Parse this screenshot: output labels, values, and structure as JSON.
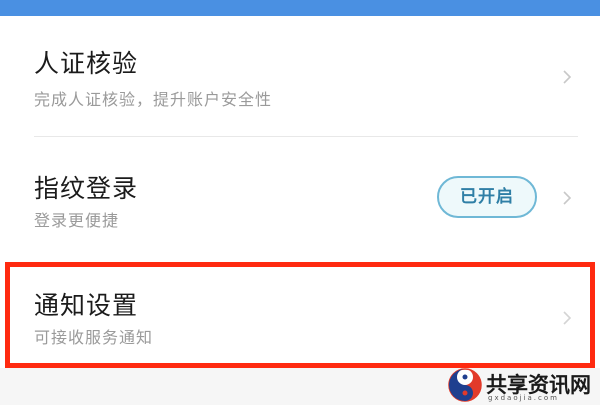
{
  "settings": {
    "items": [
      {
        "title": "人证核验",
        "subtitle": "完成人证核验，提升账户安全性"
      },
      {
        "title": "指纹登录",
        "subtitle": "登录更便捷",
        "badge": "已开启"
      },
      {
        "title": "通知设置",
        "subtitle": "可接收服务通知"
      }
    ]
  },
  "watermark": {
    "text": "共享资讯网",
    "url": "gxdaojia.com"
  },
  "colors": {
    "top_bar": "#4a90e2",
    "highlight": "#ff2a10",
    "badge_border": "#6fb8d6",
    "badge_text": "#2f7fa6"
  },
  "icons": {
    "chevron": "chevron-right-icon",
    "logo": "yin-yang-logo-icon"
  }
}
